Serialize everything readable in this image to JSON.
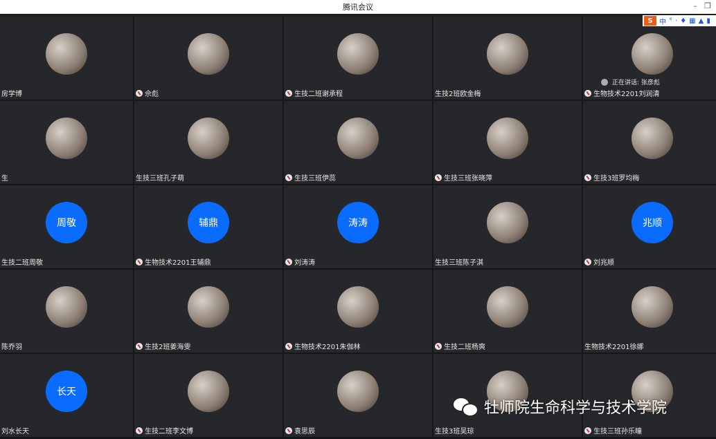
{
  "window": {
    "title": "腾讯会议"
  },
  "ime": {
    "logo": "S",
    "items": [
      "中",
      "°",
      "·",
      "♦",
      "▦",
      "▲",
      "▮"
    ]
  },
  "speaking": {
    "text": "正在讲话: 张彦彪"
  },
  "watermark": {
    "text": "牡师院生命科学与技术学院"
  },
  "tiles": [
    {
      "name": "房学博",
      "avatar_type": "image",
      "mic": false
    },
    {
      "name": "佘彪",
      "avatar_type": "image",
      "mic": true
    },
    {
      "name": "生技二班谢承程",
      "avatar_type": "image",
      "mic": true
    },
    {
      "name": "生技2班欧金梅",
      "avatar_type": "image",
      "mic": false
    },
    {
      "name": "生物技术2201刘润清",
      "avatar_type": "image",
      "mic": true
    },
    {
      "name": "生",
      "avatar_type": "image",
      "mic": false
    },
    {
      "name": "生技三班孔子萌",
      "avatar_type": "image",
      "mic": false
    },
    {
      "name": "生技三班伊蕊",
      "avatar_type": "image",
      "mic": true
    },
    {
      "name": "生技三班张晓萍",
      "avatar_type": "image",
      "mic": true
    },
    {
      "name": "生技3班罗均梅",
      "avatar_type": "image",
      "mic": true
    },
    {
      "name": "生技二班周敬",
      "avatar_type": "text",
      "avatar_text": "周敬",
      "mic": false
    },
    {
      "name": "生物技术2201王辅鼎",
      "avatar_type": "text",
      "avatar_text": "辅鼎",
      "mic": true
    },
    {
      "name": "刘涛涛",
      "avatar_type": "text",
      "avatar_text": "涛涛",
      "mic": true
    },
    {
      "name": "生技三班陈子淇",
      "avatar_type": "image",
      "mic": false
    },
    {
      "name": "刘兆顺",
      "avatar_type": "text",
      "avatar_text": "兆顺",
      "mic": true
    },
    {
      "name": "陈乔羽",
      "avatar_type": "image",
      "mic": false
    },
    {
      "name": "生技2班姜海雯",
      "avatar_type": "image",
      "mic": true
    },
    {
      "name": "生物技术2201朱伽林",
      "avatar_type": "image",
      "mic": true
    },
    {
      "name": "生技二班杨爽",
      "avatar_type": "image",
      "mic": true
    },
    {
      "name": "生物技术2201徐娜",
      "avatar_type": "image",
      "mic": false
    },
    {
      "name": "刘水长天",
      "avatar_type": "text",
      "avatar_text": "长天",
      "mic": false
    },
    {
      "name": "生技二班李文博",
      "avatar_type": "image",
      "mic": true
    },
    {
      "name": "袁思辰",
      "avatar_type": "image",
      "mic": true
    },
    {
      "name": "生技3班吴琼",
      "avatar_type": "image",
      "mic": false
    },
    {
      "name": "生技三班孙乐瞳",
      "avatar_type": "image",
      "mic": true
    }
  ]
}
